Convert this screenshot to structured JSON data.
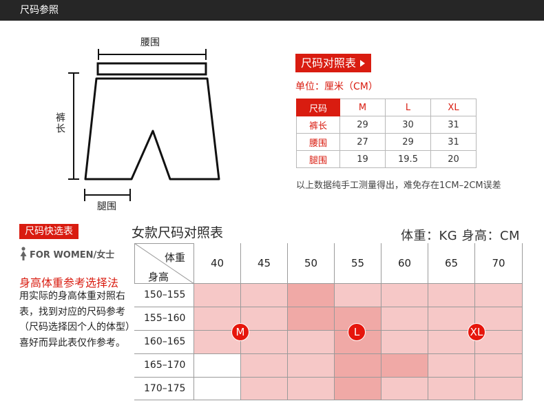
{
  "header": {
    "title": "尺码参照"
  },
  "diagram": {
    "waist_label": "腰围",
    "length_label": "裤长",
    "thigh_label": "腿围",
    "figure": "shorts-outline"
  },
  "size_chart": {
    "tag": "尺码对照表",
    "unit": "单位：厘米（CM）",
    "columns": [
      "尺码",
      "M",
      "L",
      "XL"
    ],
    "rows": [
      {
        "label": "裤长",
        "values": [
          "29",
          "30",
          "31"
        ]
      },
      {
        "label": "腰围",
        "values": [
          "27",
          "29",
          "31"
        ]
      },
      {
        "label": "腿围",
        "values": [
          "19",
          "19.5",
          "20"
        ]
      }
    ],
    "note": "以上数据纯手工测量得出，难免存在1CM–2CM误差"
  },
  "quick": {
    "tag": "尺码快选表",
    "gender": "FOR WOMEN/女士",
    "gender_icon": "woman-icon",
    "method_title": "身高体重参考选择法",
    "method_desc": "用实际的身高体重对照右表，找到对应的尺码参考（尺码选择因个人的体型）喜好而异此表仅作参考。"
  },
  "women_table": {
    "title": "女款尺码对照表",
    "units": "体重：KG  身高：CM",
    "corner_weight": "体重",
    "corner_height": "身高",
    "weights": [
      "40",
      "45",
      "50",
      "55",
      "60",
      "65",
      "70"
    ],
    "heights": [
      "150–155",
      "155–160",
      "160–165",
      "165–170",
      "170–175"
    ],
    "cell_colors": {
      "light": "#f6c8c7",
      "dark": "#f0a9a6",
      "white": "#ffffff"
    },
    "cells": [
      [
        "light",
        "light",
        "dark",
        "light",
        "light",
        "light",
        "light"
      ],
      [
        "light",
        "light",
        "dark",
        "dark",
        "light",
        "light",
        "light"
      ],
      [
        "light",
        "light",
        "light",
        "dark",
        "light",
        "light",
        "light"
      ],
      [
        "white",
        "light",
        "light",
        "dark",
        "dark",
        "light",
        "light"
      ],
      [
        "white",
        "light",
        "light",
        "dark",
        "light",
        "light",
        "light"
      ]
    ],
    "badges": [
      "M",
      "L",
      "XL"
    ],
    "badge_color": "#e6160c"
  }
}
